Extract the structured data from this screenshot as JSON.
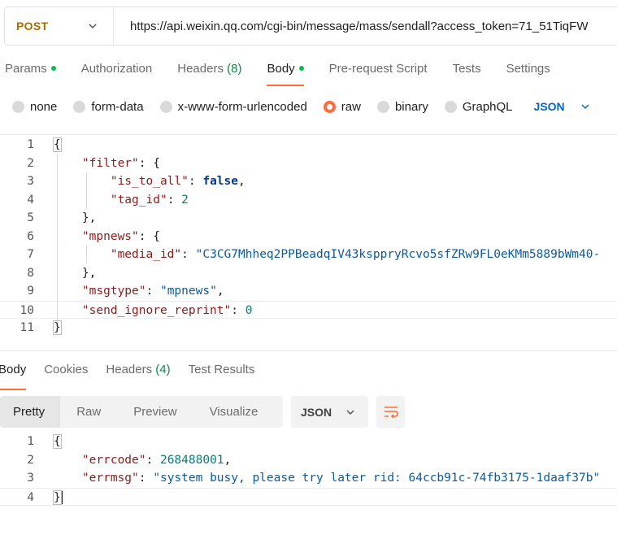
{
  "request": {
    "method": "POST",
    "url": "https://api.weixin.qq.com/cgi-bin/message/mass/sendall?access_token=71_51TiqFW"
  },
  "request_tabs": [
    {
      "label": "Params",
      "dot": true
    },
    {
      "label": "Authorization"
    },
    {
      "label": "Headers",
      "count": "(8)"
    },
    {
      "label": "Body",
      "dot": true,
      "active": true
    },
    {
      "label": "Pre-request Script"
    },
    {
      "label": "Tests"
    },
    {
      "label": "Settings"
    }
  ],
  "body_types": [
    {
      "label": "none"
    },
    {
      "label": "form-data"
    },
    {
      "label": "x-www-form-urlencoded"
    },
    {
      "label": "raw",
      "selected": true
    },
    {
      "label": "binary"
    },
    {
      "label": "GraphQL"
    }
  ],
  "body_language": "JSON",
  "request_body": {
    "line_numbers": [
      "1",
      "2",
      "3",
      "4",
      "5",
      "6",
      "7",
      "8",
      "9",
      "10",
      "11"
    ],
    "open_brace": "{",
    "key_filter": "\"filter\"",
    "key_is_to_all": "\"is_to_all\"",
    "val_is_to_all": "false",
    "key_tag_id": "\"tag_id\"",
    "val_tag_id": "2",
    "key_mpnews": "\"mpnews\"",
    "key_media_id": "\"media_id\"",
    "val_media_id": "\"C3CG7Mhheq2PPBeadqIV43ksppryRcvo5sfZRw9FL0eKMm5889bWm40-",
    "key_msgtype": "\"msgtype\"",
    "val_msgtype": "\"mpnews\"",
    "key_send_ignore": "\"send_ignore_reprint\"",
    "val_send_ignore": "0",
    "close_brace": "}"
  },
  "response_tabs": [
    {
      "label": "Body",
      "active": true
    },
    {
      "label": "Cookies"
    },
    {
      "label": "Headers",
      "count": "(4)"
    },
    {
      "label": "Test Results"
    }
  ],
  "response_views": [
    "Pretty",
    "Raw",
    "Preview",
    "Visualize"
  ],
  "response_format": "JSON",
  "response_body": {
    "line_numbers": [
      "1",
      "2",
      "3",
      "4"
    ],
    "open_brace": "{",
    "key_errcode": "\"errcode\"",
    "val_errcode": "268488001",
    "key_errmsg": "\"errmsg\"",
    "val_errmsg": "\"system busy, please try later rid: 64ccb91c-74fb3175-1daaf37b\"",
    "close_brace": "}"
  },
  "icons": {
    "method_chevron": "chevron-down-icon",
    "language_chevron": "chevron-down-icon",
    "format_chevron": "chevron-down-icon",
    "wrap": "wrap-lines-icon"
  },
  "colors": {
    "accent": "#ff6c37",
    "method": "#a86b00",
    "link": "#0265d2",
    "success_dot": "#0cbb52"
  }
}
